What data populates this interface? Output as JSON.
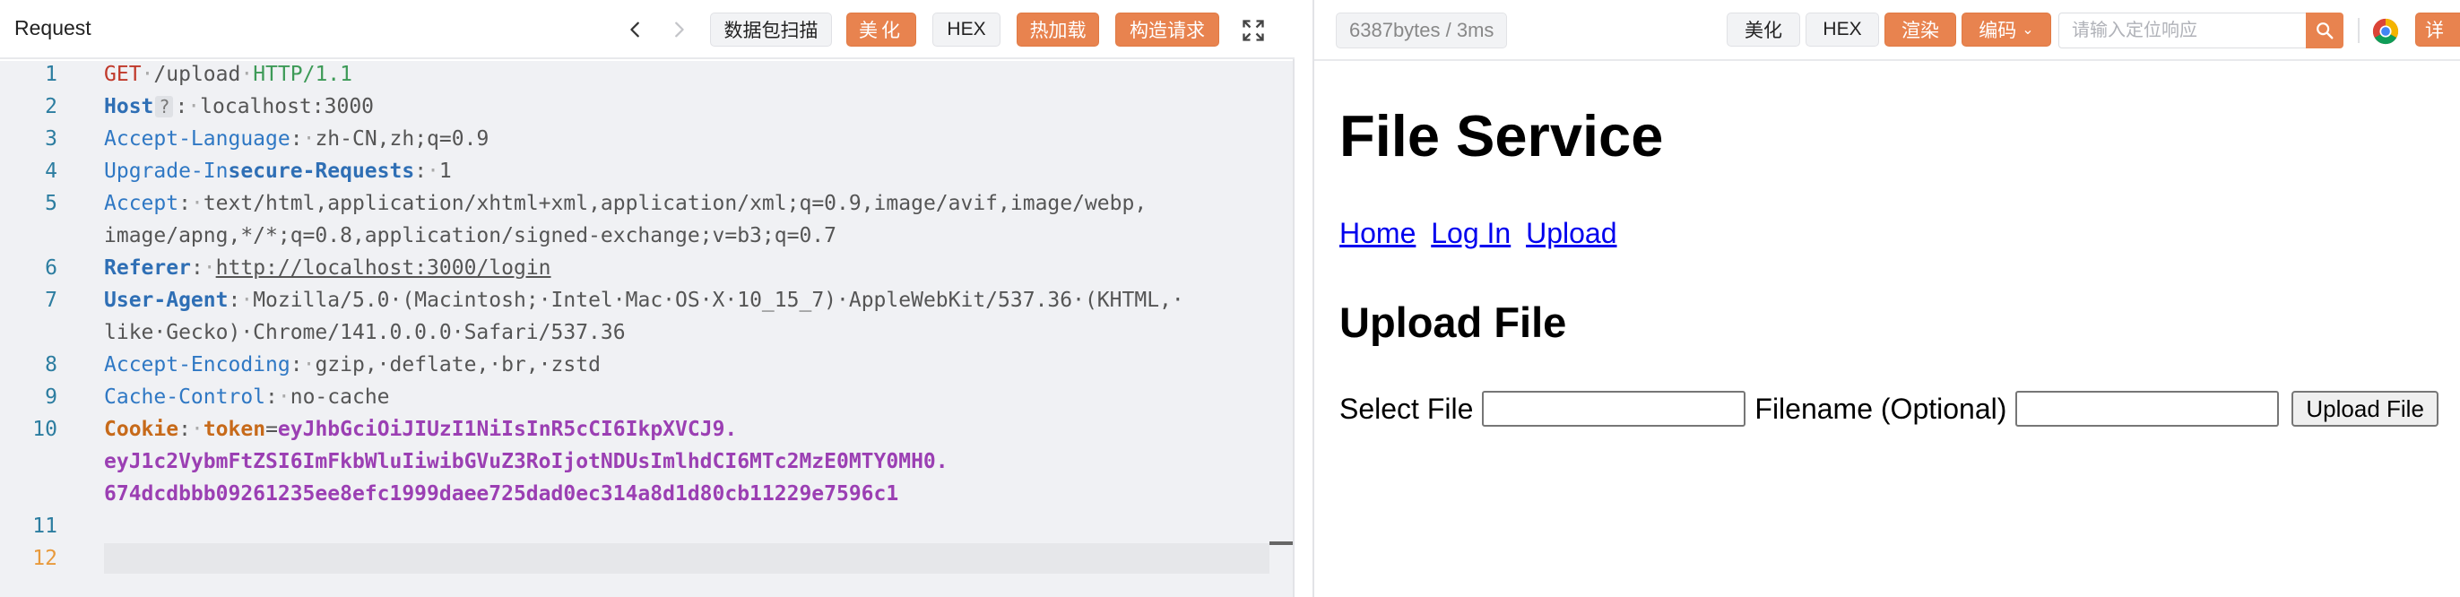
{
  "request_panel": {
    "title": "Request",
    "buttons": {
      "packet_scan": "数据包扫描",
      "beautify": "美化",
      "hex": "HEX",
      "hot_load": "热加载",
      "construct": "构造请求"
    },
    "line_numbers": [
      "1",
      "2",
      "3",
      "4",
      "5",
      "",
      "6",
      "7",
      "",
      "8",
      "9",
      "10",
      "",
      "",
      "11",
      "12"
    ],
    "lines": {
      "l1": {
        "method": "GET",
        "path": "/upload",
        "version": "HTTP/1.1"
      },
      "l2": {
        "key": "Host",
        "help": "?",
        "value": "localhost:3000"
      },
      "l3": {
        "key": "Accept-Language",
        "value": "zh-CN,zh;q=0.9"
      },
      "l4": {
        "key_a": "Upgrade-In",
        "key_b": "secure-Requests",
        "value": "1"
      },
      "l5": {
        "key": "Accept",
        "value": "text/html,application/xhtml+xml,application/xml;q=0.9,image/avif,image/webp,",
        "value_wrap": "image/apng,*/*;q=0.8,application/signed-exchange;v=b3;q=0.7"
      },
      "l6": {
        "key": "Referer",
        "value": "http://localhost:3000/login"
      },
      "l7": {
        "key": "User-Agent",
        "value": "Mozilla/5.0·(Macintosh;·Intel·Mac·OS·X·10_15_7)·AppleWebKit/537.36·(KHTML,·",
        "value_wrap": "like·Gecko)·Chrome/141.0.0.0·Safari/537.36"
      },
      "l8": {
        "key": "Accept-Encoding",
        "value": "gzip,·deflate,·br,·zstd"
      },
      "l9": {
        "key": "Cache-Control",
        "value": "no-cache"
      },
      "l10": {
        "key": "Cookie",
        "cookie_name": "token",
        "eq": "=",
        "jwt_part1": "eyJhbGciOiJIUzI1NiIsInR5cCI6IkpXVCJ9.",
        "jwt_part2": "eyJ1c2VybmFtZSI6ImFkbWluIiwibGVuZ3RoIjotNDUsImlhdCI6MTc2MzE0MTY0MH0.",
        "jwt_part3": "674dcdbbb09261235ee8efc1999daee725dad0ec314a8d1d80cb11229e7596c1"
      }
    }
  },
  "response_panel": {
    "stats": "6387bytes / 3ms",
    "buttons": {
      "beautify": "美化",
      "hex": "HEX",
      "render": "渲染",
      "encoding": "编码",
      "detail": "详"
    },
    "locate_placeholder": "请输入定位响应",
    "rendered_page": {
      "h1": "File Service",
      "nav": [
        "Home",
        "Log In",
        "Upload"
      ],
      "h2": "Upload File",
      "select_label": "Select File",
      "filename_label": "Filename (Optional)",
      "submit": "Upload File"
    }
  },
  "colors": {
    "accent_orange": "#e8834f",
    "gutter_blue": "#2c7da0",
    "active_line_number": "#e89a3c",
    "link_blue": "#0000ee"
  },
  "icons": [
    "chevron-left-icon",
    "chevron-right-icon",
    "fullscreen-icon",
    "search-icon",
    "chrome-icon"
  ]
}
